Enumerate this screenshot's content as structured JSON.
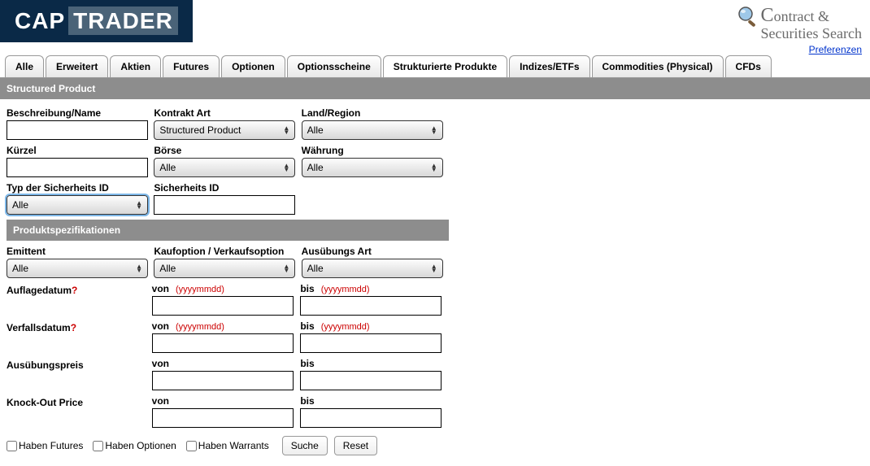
{
  "header": {
    "logo_cap": "CAP",
    "logo_trader": "TRADER",
    "search_title_1": "ontract &",
    "search_title_2": "Securities Search",
    "prefs": "Preferenzen"
  },
  "tabs": {
    "t0": "Alle",
    "t1": "Erweitert",
    "t2": "Aktien",
    "t3": "Futures",
    "t4": "Optionen",
    "t5": "Optionsscheine",
    "t6": "Strukturierte Produkte",
    "t7": "Indizes/ETFs",
    "t8": "Commodities (Physical)",
    "t9": "CFDs"
  },
  "section": {
    "structured": "Structured Product",
    "prodspec": "Produktspezifikationen"
  },
  "labels": {
    "beschreibung": "Beschreibung/Name",
    "kontrakt_art": "Kontrakt Art",
    "land_region": "Land/Region",
    "kuerzel": "Kürzel",
    "boerse": "Börse",
    "waehrung": "Währung",
    "typ_sicherheit": "Typ der Sicherheits ID",
    "sicherheits_id": "Sicherheits ID",
    "emittent": "Emittent",
    "kaufverkauf": "Kaufoption / Verkaufsoption",
    "ausuebungsart": "Ausübungs Art",
    "auflagedatum": "Auflagedatum",
    "verfallsdatum": "Verfallsdatum",
    "ausuebungspreis": "Ausübungspreis",
    "knockout": "Knock-Out Price",
    "von": "von",
    "bis": "bis",
    "yyyymmdd": "(yyyymmdd)"
  },
  "values": {
    "kontrakt_art": "Structured Product",
    "land_region": "Alle",
    "boerse": "Alle",
    "waehrung": "Alle",
    "typ_sicherheit": "Alle",
    "emittent": "Alle",
    "kaufverkauf": "Alle",
    "ausuebungsart": "Alle"
  },
  "checkboxes": {
    "haben_futures": "Haben Futures",
    "haben_optionen": "Haben Optionen",
    "haben_warrants": "Haben Warrants"
  },
  "buttons": {
    "suche": "Suche",
    "reset": "Reset"
  }
}
